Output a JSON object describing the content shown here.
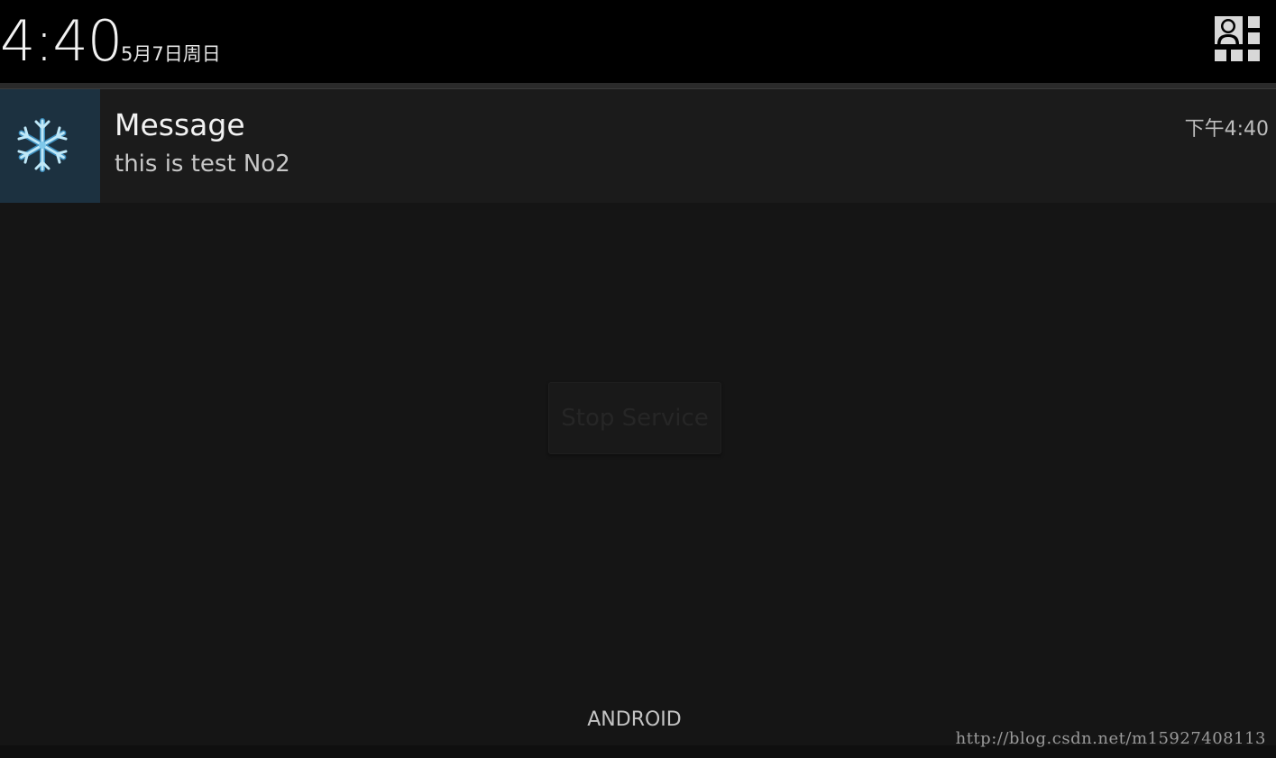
{
  "status_header": {
    "time": "4:40",
    "date": "5月7日周日",
    "settings_icon": "quick-settings-icon"
  },
  "notification": {
    "icon": "snowflake-icon",
    "title": "Message",
    "text": "this is test No2",
    "time": "下午4:40"
  },
  "background_app": {
    "button_label": "Stop Service"
  },
  "footer": {
    "carrier_label": "ANDROID",
    "watermark": "http://blog.csdn.net/m15927408113"
  },
  "colors": {
    "header_background": "#000000",
    "shade_background": "#151515",
    "notification_background": "#1b1b1b",
    "notification_icon_background": "#1c3140",
    "snowflake_color": "#7ec8ea"
  }
}
